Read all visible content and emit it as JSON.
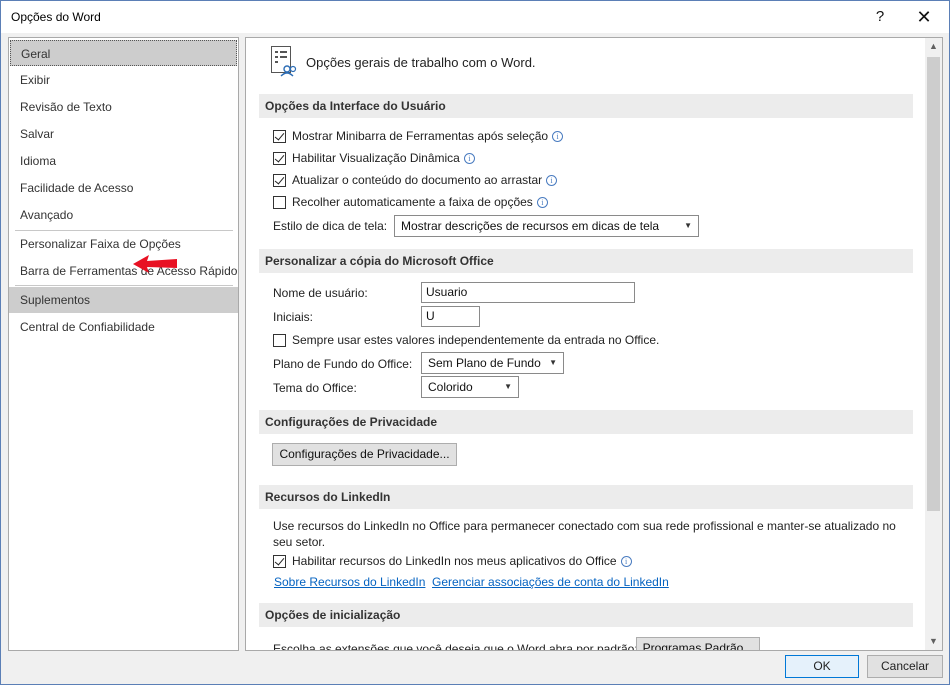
{
  "window": {
    "title": "Opções do Word",
    "help_label": "?",
    "close_label": "✕"
  },
  "nav": {
    "items": [
      {
        "label": "Geral"
      },
      {
        "label": "Exibir"
      },
      {
        "label": "Revisão de Texto"
      },
      {
        "label": "Salvar"
      },
      {
        "label": "Idioma"
      },
      {
        "label": "Facilidade de Acesso"
      },
      {
        "label": "Avançado"
      },
      {
        "label": "Personalizar Faixa de Opções"
      },
      {
        "label": "Barra de Ferramentas de Acesso Rápido"
      },
      {
        "label": "Suplementos"
      },
      {
        "label": "Central de Confiabilidade"
      }
    ],
    "selected": "Geral",
    "highlighted": "Suplementos",
    "arrow_color": "#e81123"
  },
  "content": {
    "header": "Opções gerais de trabalho com o Word.",
    "ui_section": {
      "title": "Opções da Interface do Usuário",
      "checkboxes": [
        {
          "label": "Mostrar Minibarra de Ferramentas após seleção",
          "checked": true
        },
        {
          "label": "Habilitar Visualização Dinâmica",
          "checked": true
        },
        {
          "label": "Atualizar o conteúdo do documento ao arrastar",
          "checked": true
        },
        {
          "label": "Recolher automaticamente a faixa de opções",
          "checked": false
        }
      ],
      "tooltip_label": "Estilo de dica de tela:",
      "tooltip_value": "Mostrar descrições de recursos em dicas de tela"
    },
    "office_section": {
      "title": "Personalizar a cópia do Microsoft Office",
      "username_label": "Nome de usuário:",
      "username_value": "Usuario",
      "initials_label": "Iniciais:",
      "initials_value": "U",
      "always_use_label": "Sempre usar estes valores independentemente da entrada no Office.",
      "always_use_checked": false,
      "background_label": "Plano de Fundo do Office:",
      "background_value": "Sem Plano de Fundo",
      "theme_label": "Tema do Office:",
      "theme_value": "Colorido"
    },
    "privacy_section": {
      "title": "Configurações de Privacidade",
      "button_label": "Configurações de Privacidade..."
    },
    "linkedin_section": {
      "title": "Recursos do LinkedIn",
      "description": "Use recursos do LinkedIn no Office para permanecer conectado com sua rede profissional e manter-se atualizado no seu setor.",
      "checkbox_label": "Habilitar recursos do LinkedIn nos meus aplicativos do Office",
      "checkbox_checked": true,
      "link_about": "Sobre Recursos do LinkedIn",
      "link_manage": "Gerenciar associações de conta do LinkedIn"
    },
    "startup_section": {
      "title": "Opções de inicialização",
      "description": "Escolha as extensões que você deseja que o Word abra por padrão:",
      "button_label": "Programas Padrão..."
    }
  },
  "footer": {
    "ok_label": "OK",
    "cancel_label": "Cancelar"
  }
}
